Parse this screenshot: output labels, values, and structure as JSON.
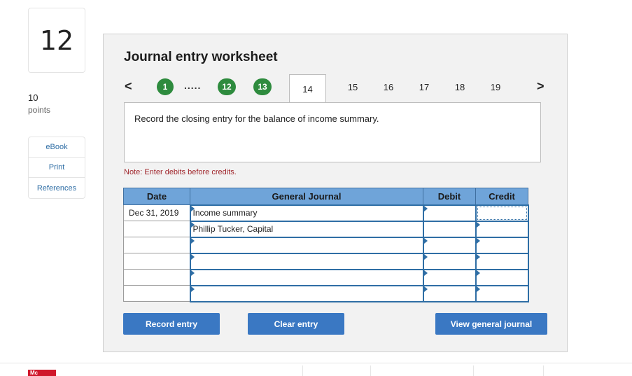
{
  "question": {
    "number": "12",
    "points_value": "10",
    "points_label": "points"
  },
  "side_links": [
    "eBook",
    "Print",
    "References"
  ],
  "worksheet": {
    "title": "Journal entry worksheet",
    "nav": {
      "prev": "<",
      "next": ">",
      "completed_steps": [
        "1",
        "12",
        "13"
      ],
      "ellipsis": ".....",
      "active_step": "14",
      "pending_steps": [
        "15",
        "16",
        "17",
        "18",
        "19"
      ]
    },
    "instruction": "Record the closing entry for the balance of income summary.",
    "note": "Note: Enter debits before credits.",
    "table": {
      "headers": {
        "date": "Date",
        "journal": "General Journal",
        "debit": "Debit",
        "credit": "Credit"
      },
      "rows": [
        {
          "date": "Dec 31, 2019",
          "account": "Income summary",
          "debit": "",
          "credit": ""
        },
        {
          "date": "",
          "account": "Phillip Tucker, Capital",
          "debit": "",
          "credit": ""
        },
        {
          "date": "",
          "account": "",
          "debit": "",
          "credit": ""
        },
        {
          "date": "",
          "account": "",
          "debit": "",
          "credit": ""
        },
        {
          "date": "",
          "account": "",
          "debit": "",
          "credit": ""
        },
        {
          "date": "",
          "account": "",
          "debit": "",
          "credit": ""
        }
      ]
    },
    "buttons": {
      "record": "Record entry",
      "clear": "Clear entry",
      "view": "View general journal"
    }
  },
  "colors": {
    "step_green": "#2e8b3e",
    "header_blue": "#6fa4d9",
    "button_blue": "#3a78c3",
    "note_red": "#a0262c"
  }
}
